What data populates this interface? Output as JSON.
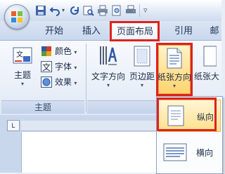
{
  "quick_access": {
    "icons": [
      "office-logo-icon",
      "save-icon",
      "undo-icon",
      "redo-icon",
      "print-preview-icon",
      "print-icon",
      "zoom-print-icon",
      "quick-print-icon",
      "customize-dropdown-icon"
    ]
  },
  "tabs": [
    {
      "label": "开始"
    },
    {
      "label": "插入"
    },
    {
      "label": "页面布局",
      "active": true
    },
    {
      "label": "引用"
    },
    {
      "label": "邮"
    }
  ],
  "ribbon": {
    "theme_group": {
      "label": "主题",
      "themes_button": "主题",
      "colors": "颜色",
      "fonts": "字体",
      "effects": "效果"
    },
    "page_setup": {
      "text_direction": "文字方向",
      "margins": "页边距",
      "orientation": "纸张方向",
      "size": "纸张大"
    }
  },
  "orientation_menu": {
    "items": [
      {
        "label": "纵向",
        "highlighted": true
      },
      {
        "label": "横向",
        "highlighted": false
      }
    ]
  },
  "ruler": {
    "corner": "L"
  },
  "colors": {
    "highlight": "#e0211e",
    "ribbon_bg": "#e8eef8",
    "menu_hover": "#ffe08c"
  }
}
